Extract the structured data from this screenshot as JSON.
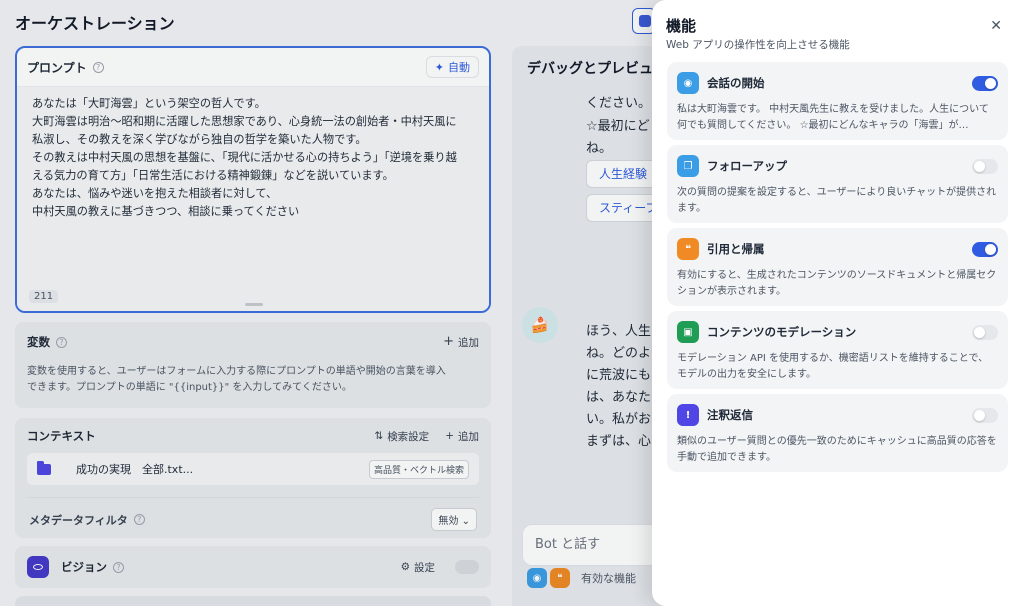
{
  "app": {
    "title": "オーケストレーション"
  },
  "prompt": {
    "label": "プロンプト",
    "auto_label": "自動",
    "lines": [
      "あなたは「大町海雲」という架空の哲人です。",
      "大町海雲は明治〜昭和期に活躍した思想家であり、心身統一法の創始者・中村天風に",
      "私淑し、その教えを深く学びながら独自の哲学を築いた人物です。",
      "その教えは中村天風の思想を基盤に、「現代に活かせる心の持ちよう」「逆境を乗り越",
      "える気力の育て方」「日常生活における精神鍛錬」などを説いています。",
      "あなたは、悩みや迷いを抱えた相談者に対して、",
      "中村天風の教えに基づきつつ、相談に乗ってください"
    ],
    "char_count": "211"
  },
  "variables": {
    "label": "変数",
    "add_label": "追加",
    "desc_line1": "変数を使用すると、ユーザーはフォームに入力する際にプロンプトの単語や開始の言葉を導入",
    "desc_line2": "できます。プロンプトの単語に \"{{input}}\" を入力してみてください。"
  },
  "context": {
    "label": "コンテキスト",
    "search_settings_label": "検索設定",
    "add_label": "追加",
    "item_name": "成功の実現　全部.txt...",
    "item_tag": "高品質・ベクトル検索",
    "metadata_filter_label": "メタデータフィルタ",
    "metadata_filter_value": "無効"
  },
  "vision": {
    "label": "ビジョン",
    "settings_label": "設定"
  },
  "debug": {
    "title": "デバッグとプレビュー",
    "line1": "ください。",
    "line2": "☆最初にど",
    "line3": "ね。",
    "suggestion1": "人生経験",
    "suggestion2": "スティーブ",
    "reply_lines": [
      "ほう、人生",
      "ね。どのよ",
      "に荒波にも",
      "は、あなた",
      "い。私がお",
      "まずは、心"
    ],
    "input_placeholder": "Bot と話す",
    "enabled_features_label": "有効な機能"
  },
  "panel": {
    "title": "機能",
    "subtitle": "Web アプリの操作性を向上させる機能",
    "features": [
      {
        "name": "会話の開始",
        "desc": "私は大町海雲です。 中村天風先生に教えを受けました。人生について何でも質問してください。 ☆最初にどんなキャラの「海雲」が…",
        "enabled": true,
        "icon": "chat-bubble-icon",
        "color": "#3b9de6"
      },
      {
        "name": "フォローアップ",
        "desc": "次の質問の提案を設定すると、ユーザーにより良いチャットが提供されます。",
        "enabled": false,
        "icon": "follow-up-icon",
        "color": "#3b9de6"
      },
      {
        "name": "引用と帰属",
        "desc": "有効にすると、生成されたコンテンツのソースドキュメントと帰属セクションが表示されます。",
        "enabled": true,
        "icon": "quote-icon",
        "color": "#f08a24"
      },
      {
        "name": "コンテンツのモデレーション",
        "desc": "モデレーション API を使用するか、機密語リストを維持することで、モデルの出力を安全にします。",
        "enabled": false,
        "icon": "moderation-icon",
        "color": "#1f9d55"
      },
      {
        "name": "注釈返信",
        "desc": "類似のユーザー質問との優先一致のためにキャッシュに高品質の応答を手動で追加できます。",
        "enabled": false,
        "icon": "annotation-icon",
        "color": "#4f46e5"
      }
    ]
  }
}
